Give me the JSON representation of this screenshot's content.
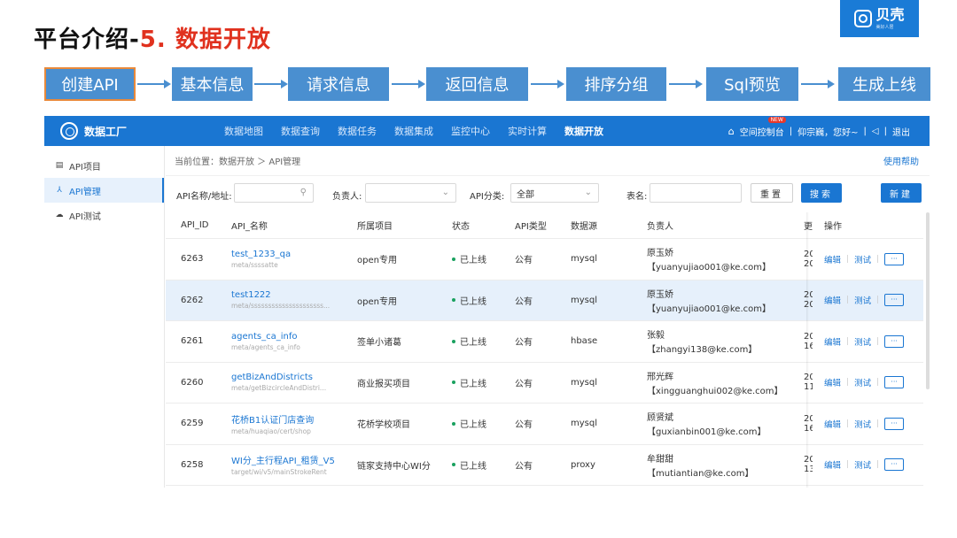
{
  "slide": {
    "title_prefix": "平台介绍-",
    "title_accent": "5. 数据开放",
    "brand": "贝壳",
    "brand_sub": "美好人居"
  },
  "flow_steps": [
    "创建API",
    "基本信息",
    "请求信息",
    "返回信息",
    "排序分组",
    "Sql预览",
    "生成上线"
  ],
  "app": {
    "name": "数据工厂",
    "nav": [
      "数据地图",
      "数据查询",
      "数据任务",
      "数据集成",
      "监控中心",
      "实时计算",
      "数据开放"
    ],
    "active_nav": "数据开放",
    "console": "空间控制台",
    "new_badge": "NEW",
    "greeting": "仰宗巍，您好~",
    "speaker": "◁",
    "logout": "退出"
  },
  "sidebar": {
    "items": [
      {
        "label": "API项目",
        "icon": "doc-icon"
      },
      {
        "label": "API管理",
        "icon": "tree-icon"
      },
      {
        "label": "API测试",
        "icon": "cloud-icon"
      }
    ]
  },
  "breadcrumb": {
    "text": "当前位置：数据开放 ＞ API管理",
    "help": "使用帮助"
  },
  "filter": {
    "name_label": "API名称/地址:",
    "name_value": "",
    "owner_label": "负责人:",
    "owner_value": "",
    "category_label": "API分类:",
    "category_value": "全部",
    "table_label": "表名:",
    "table_value": "",
    "reset": "重置",
    "search": "搜索",
    "create": "新建"
  },
  "table": {
    "headers": [
      "API_ID",
      "API_名称",
      "所属项目",
      "状态",
      "API类型",
      "数据源",
      "负责人",
      "更新",
      "操作"
    ],
    "op_edit": "编辑",
    "op_test": "测试",
    "op_more": "···",
    "rows": [
      {
        "id": "6263",
        "name": "test_1233_qa",
        "path": "meta/ssssatte",
        "project": "open专用",
        "status": "已上线",
        "type": "公有",
        "source": "mysql",
        "owner": "原玉娇",
        "owner_email": "【yuanyujiao001@ke.com】",
        "update1": "20",
        "update2": "20"
      },
      {
        "id": "6262",
        "name": "test1222",
        "path": "meta/sssssssssssssssssssss...",
        "project": "open专用",
        "status": "已上线",
        "type": "公有",
        "source": "mysql",
        "owner": "原玉娇",
        "owner_email": "【yuanyujiao001@ke.com】",
        "update1": "20",
        "update2": "20"
      },
      {
        "id": "6261",
        "name": "agents_ca_info",
        "path": "meta/agents_ca_info",
        "project": "签单小诸葛",
        "status": "已上线",
        "type": "公有",
        "source": "hbase",
        "owner": "张毅",
        "owner_email": "【zhangyi138@ke.com】",
        "update1": "20",
        "update2": "16"
      },
      {
        "id": "6260",
        "name": "getBizAndDistricts",
        "path": "meta/getBizcircleAndDistri...",
        "project": "商业报买项目",
        "status": "已上线",
        "type": "公有",
        "source": "mysql",
        "owner": "邢光辉",
        "owner_email": "【xingguanghui002@ke.com】",
        "update1": "20",
        "update2": "11"
      },
      {
        "id": "6259",
        "name": "花桥B1认证门店查询",
        "path": "meta/huaqiao/cert/shop",
        "project": "花桥学校项目",
        "status": "已上线",
        "type": "公有",
        "source": "mysql",
        "owner": "顾贤斌",
        "owner_email": "【guxianbin001@ke.com】",
        "update1": "20",
        "update2": "16"
      },
      {
        "id": "6258",
        "name": "WI分_主行程API_租赁_V5",
        "path": "target/wi/v5/mainStrokeRent",
        "project": "链家支持中心WI分",
        "status": "已上线",
        "type": "公有",
        "source": "proxy",
        "owner": "牟甜甜",
        "owner_email": "【mutiantian@ke.com】",
        "update1": "20",
        "update2": "13"
      }
    ]
  }
}
